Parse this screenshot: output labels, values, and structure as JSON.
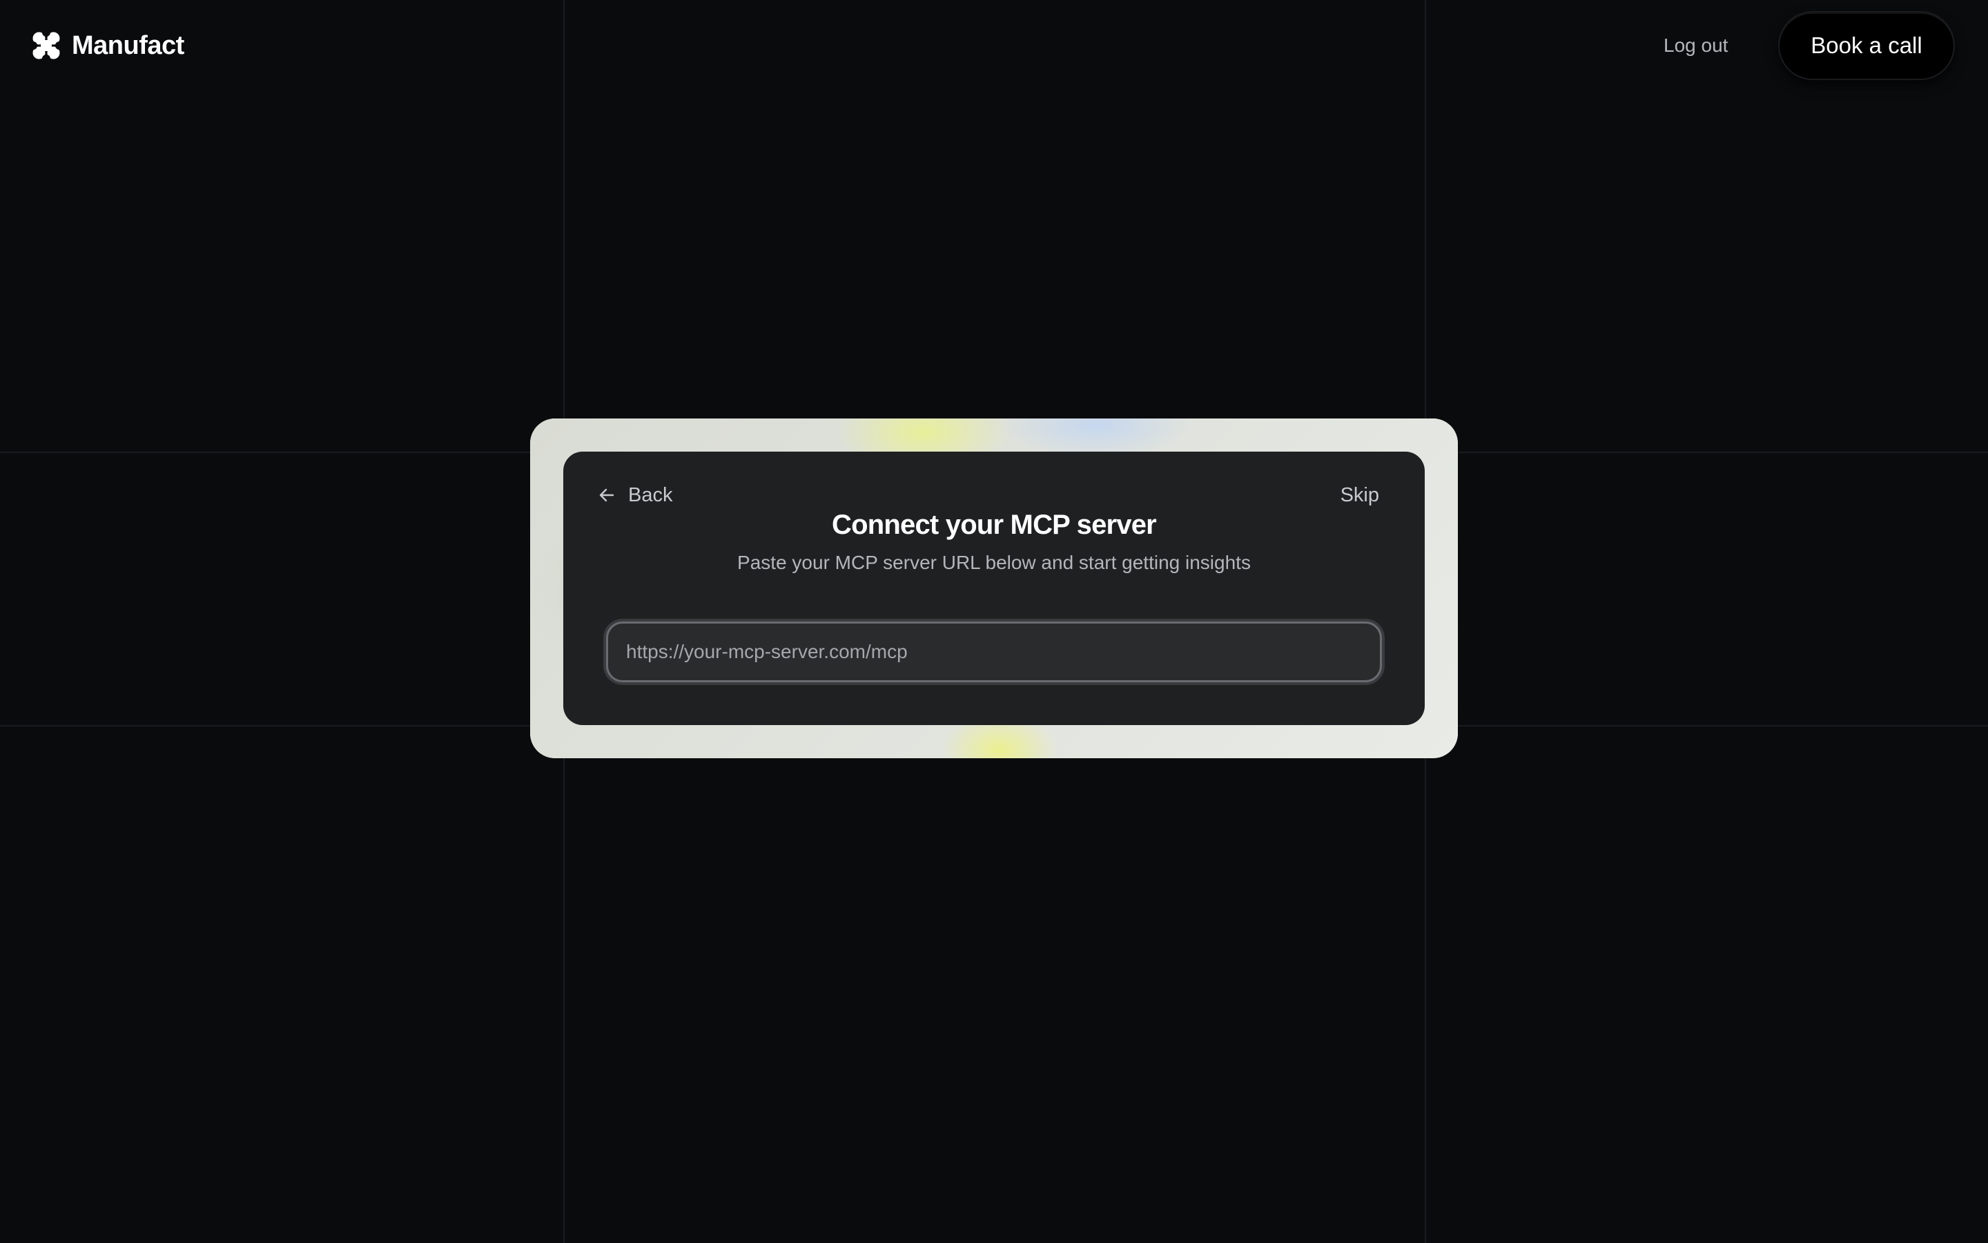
{
  "header": {
    "brand_name": "Manufact",
    "brand_icon": "four-dot-cluster-logo",
    "logout_label": "Log out",
    "book_call_label": "Book a call"
  },
  "card": {
    "back_label": "Back",
    "back_icon": "arrow-left-icon",
    "skip_label": "Skip",
    "title": "Connect your MCP server",
    "subtitle": "Paste your MCP server URL below and start getting insights",
    "url_input": {
      "value": "",
      "placeholder": "https://your-mcp-server.com/mcp"
    }
  },
  "colors": {
    "page_background": "#0a0b0d",
    "card_background": "#1f2022",
    "frame_background": "#dcdfd9",
    "button_background": "#000000"
  }
}
